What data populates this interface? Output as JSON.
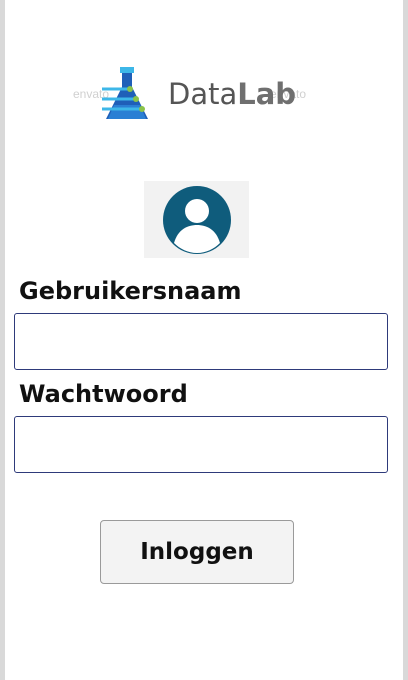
{
  "logo": {
    "text_data": "Data",
    "text_lab": "Lab",
    "watermark_left": "envato",
    "watermark_right": "envato",
    "icon": "flask-icon",
    "colors": {
      "flask_blue": "#1f5fb8",
      "flask_light": "#3db7e8",
      "node_green": "#8bc34a"
    }
  },
  "avatar": {
    "icon": "user-avatar-icon",
    "color": "#0f5c7c"
  },
  "form": {
    "username_label": "Gebruikersnaam",
    "username_value": "",
    "password_label": "Wachtwoord",
    "password_value": "",
    "login_button": "Inloggen",
    "field_border_color": "#2e3a7a"
  }
}
